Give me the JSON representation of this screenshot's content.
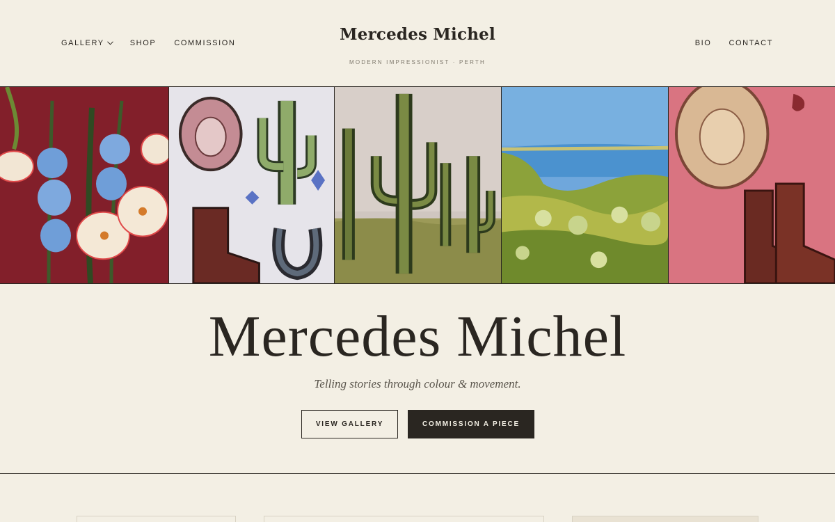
{
  "header": {
    "nav_left": [
      {
        "label": "GALLERY",
        "has_dropdown": true
      },
      {
        "label": "SHOP"
      },
      {
        "label": "COMMISSION"
      }
    ],
    "brand_name": "Mercedes Michel",
    "brand_tagline": "MODERN IMPRESSIONIST · PERTH",
    "nav_right": [
      {
        "label": "BIO"
      },
      {
        "label": "CONTACT"
      }
    ]
  },
  "paintings": [
    {
      "subject": "lilies-and-blue-flowers-painting",
      "background": "#7a1c25"
    },
    {
      "subject": "cowboy-hat-cactus-boot-horseshoe-painting",
      "background": "#e6e4ea"
    },
    {
      "subject": "saguaro-cacti-painting",
      "background": "#cfc6c0"
    },
    {
      "subject": "lake-landscape-painting",
      "background": "#6fa7dc"
    },
    {
      "subject": "cowboy-hat-and-boots-pink-painting",
      "background": "#d56c7a"
    }
  ],
  "hero": {
    "title": "Mercedes Michel",
    "subtitle": "Telling stories through colour & movement.",
    "primary_button": "VIEW GALLERY",
    "secondary_button": "COMMISSION A PIECE"
  },
  "colors": {
    "background": "#f3efe4",
    "ink": "#2a2621",
    "muted": "#7e786c"
  }
}
